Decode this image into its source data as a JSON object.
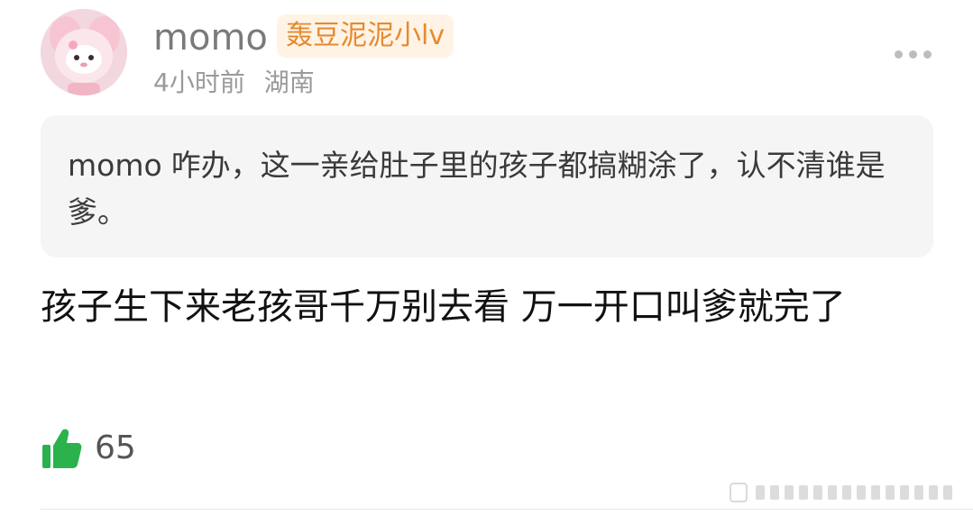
{
  "comment": {
    "username": "momo",
    "badge": "轰豆泥泥小lv",
    "time": "4小时前",
    "location": "湖南",
    "quote": {
      "username": "momo",
      "text": "咋办，这一亲给肚子里的孩子都搞糊涂了，认不清谁是爹。"
    },
    "text": "孩子生下来老孩哥千万别去看 万一开口叫爹就完了",
    "likes": "65"
  },
  "colors": {
    "badge_text": "#e58a2e",
    "badge_bg": "#fff3e6",
    "like_green": "#2bb24c",
    "quote_bg": "#f5f5f5"
  },
  "icons": {
    "avatar": "plush-toy-avatar",
    "more": "more-dots-icon",
    "like": "thumbs-up-icon"
  }
}
